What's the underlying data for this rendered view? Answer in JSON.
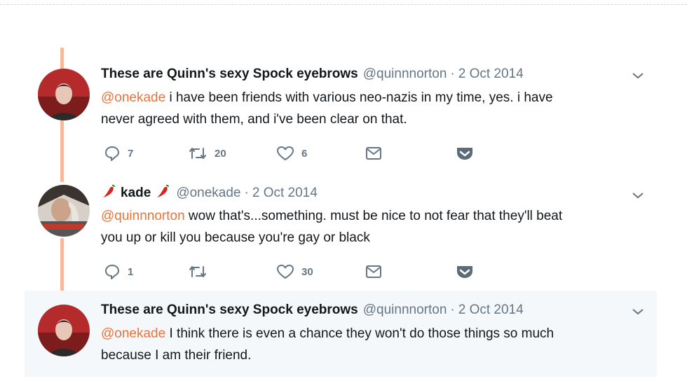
{
  "tweets": [
    {
      "name": "These are Quinn's sexy Spock eyebrows",
      "handle": "@quinnnorton",
      "separator": "·",
      "date": "2 Oct 2014",
      "mention": "@onekade",
      "body_line1": " i have been friends with various neo-nazis in my time, yes. i have",
      "body_line2": "never agreed with them, and i've been clear on that.",
      "replies": "7",
      "retweets": "20",
      "likes": "6"
    },
    {
      "name": "kade",
      "handle": "@onekade",
      "separator": "·",
      "date": "2 Oct 2014",
      "mention": "@quinnnorton",
      "body_line1": " wow that's...something. must be nice to not fear that they'll beat",
      "body_line2": "you up or kill you because you're gay or black",
      "replies": "1",
      "retweets": "",
      "likes": "30"
    },
    {
      "name": "These are Quinn's sexy Spock eyebrows",
      "handle": "@quinnnorton",
      "separator": "·",
      "date": "2 Oct 2014",
      "mention": "@onekade",
      "body_line1": " I think there is even a chance they won't do those things so much",
      "body_line2": "because I am their friend."
    }
  ],
  "colors": {
    "mention": "#e8743b",
    "thread_line": "#f6b99a",
    "secondary_text": "#657786",
    "highlight_bg": "#f5f8fa",
    "pocket": "#5c6b7a"
  },
  "icons": [
    "reply-icon",
    "retweet-icon",
    "like-icon",
    "message-icon",
    "pocket-icon",
    "chevron-down-icon",
    "chili-pepper-icon"
  ]
}
